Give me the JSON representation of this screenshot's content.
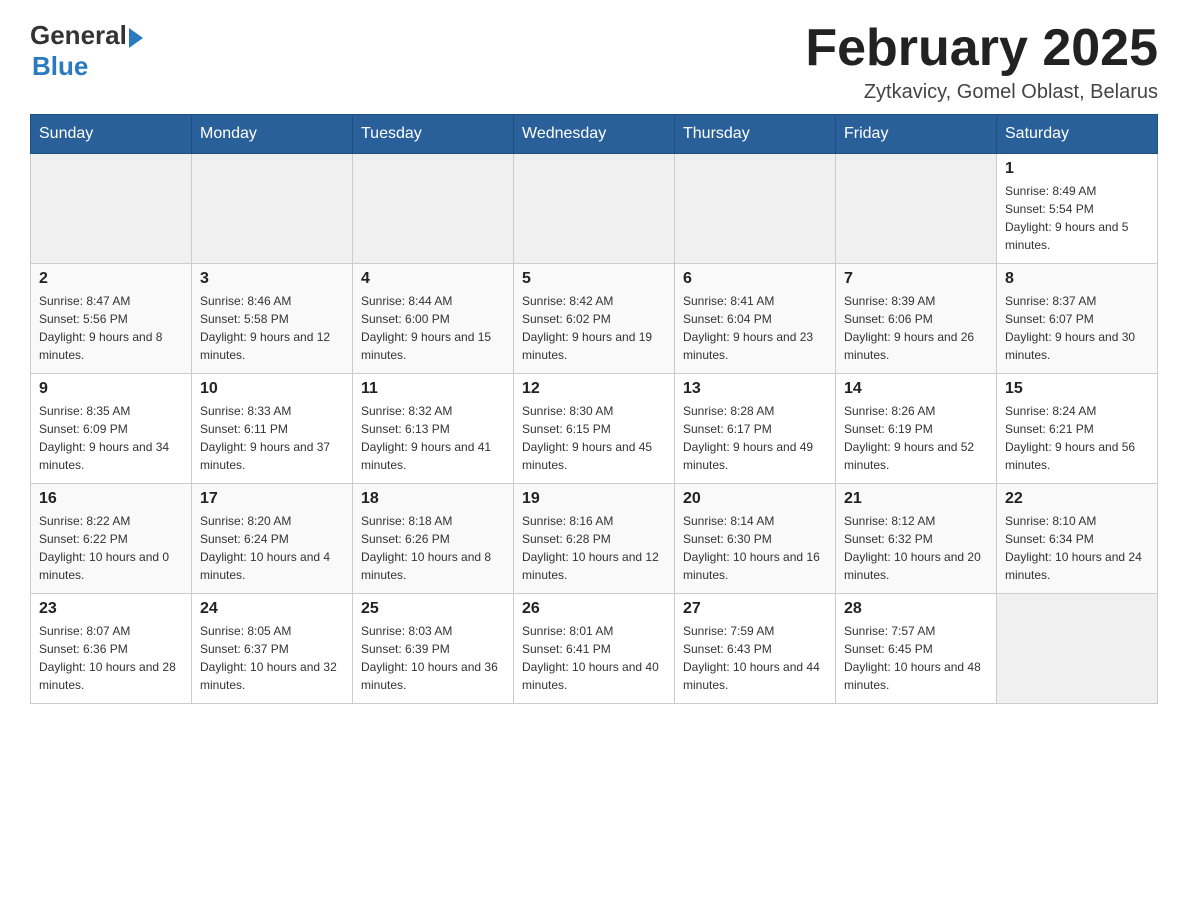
{
  "header": {
    "logo_general": "General",
    "logo_blue": "Blue",
    "month": "February 2025",
    "location": "Zytkavicy, Gomel Oblast, Belarus"
  },
  "days_of_week": [
    "Sunday",
    "Monday",
    "Tuesday",
    "Wednesday",
    "Thursday",
    "Friday",
    "Saturday"
  ],
  "weeks": [
    [
      {
        "day": "",
        "info": ""
      },
      {
        "day": "",
        "info": ""
      },
      {
        "day": "",
        "info": ""
      },
      {
        "day": "",
        "info": ""
      },
      {
        "day": "",
        "info": ""
      },
      {
        "day": "",
        "info": ""
      },
      {
        "day": "1",
        "info": "Sunrise: 8:49 AM\nSunset: 5:54 PM\nDaylight: 9 hours and 5 minutes."
      }
    ],
    [
      {
        "day": "2",
        "info": "Sunrise: 8:47 AM\nSunset: 5:56 PM\nDaylight: 9 hours and 8 minutes."
      },
      {
        "day": "3",
        "info": "Sunrise: 8:46 AM\nSunset: 5:58 PM\nDaylight: 9 hours and 12 minutes."
      },
      {
        "day": "4",
        "info": "Sunrise: 8:44 AM\nSunset: 6:00 PM\nDaylight: 9 hours and 15 minutes."
      },
      {
        "day": "5",
        "info": "Sunrise: 8:42 AM\nSunset: 6:02 PM\nDaylight: 9 hours and 19 minutes."
      },
      {
        "day": "6",
        "info": "Sunrise: 8:41 AM\nSunset: 6:04 PM\nDaylight: 9 hours and 23 minutes."
      },
      {
        "day": "7",
        "info": "Sunrise: 8:39 AM\nSunset: 6:06 PM\nDaylight: 9 hours and 26 minutes."
      },
      {
        "day": "8",
        "info": "Sunrise: 8:37 AM\nSunset: 6:07 PM\nDaylight: 9 hours and 30 minutes."
      }
    ],
    [
      {
        "day": "9",
        "info": "Sunrise: 8:35 AM\nSunset: 6:09 PM\nDaylight: 9 hours and 34 minutes."
      },
      {
        "day": "10",
        "info": "Sunrise: 8:33 AM\nSunset: 6:11 PM\nDaylight: 9 hours and 37 minutes."
      },
      {
        "day": "11",
        "info": "Sunrise: 8:32 AM\nSunset: 6:13 PM\nDaylight: 9 hours and 41 minutes."
      },
      {
        "day": "12",
        "info": "Sunrise: 8:30 AM\nSunset: 6:15 PM\nDaylight: 9 hours and 45 minutes."
      },
      {
        "day": "13",
        "info": "Sunrise: 8:28 AM\nSunset: 6:17 PM\nDaylight: 9 hours and 49 minutes."
      },
      {
        "day": "14",
        "info": "Sunrise: 8:26 AM\nSunset: 6:19 PM\nDaylight: 9 hours and 52 minutes."
      },
      {
        "day": "15",
        "info": "Sunrise: 8:24 AM\nSunset: 6:21 PM\nDaylight: 9 hours and 56 minutes."
      }
    ],
    [
      {
        "day": "16",
        "info": "Sunrise: 8:22 AM\nSunset: 6:22 PM\nDaylight: 10 hours and 0 minutes."
      },
      {
        "day": "17",
        "info": "Sunrise: 8:20 AM\nSunset: 6:24 PM\nDaylight: 10 hours and 4 minutes."
      },
      {
        "day": "18",
        "info": "Sunrise: 8:18 AM\nSunset: 6:26 PM\nDaylight: 10 hours and 8 minutes."
      },
      {
        "day": "19",
        "info": "Sunrise: 8:16 AM\nSunset: 6:28 PM\nDaylight: 10 hours and 12 minutes."
      },
      {
        "day": "20",
        "info": "Sunrise: 8:14 AM\nSunset: 6:30 PM\nDaylight: 10 hours and 16 minutes."
      },
      {
        "day": "21",
        "info": "Sunrise: 8:12 AM\nSunset: 6:32 PM\nDaylight: 10 hours and 20 minutes."
      },
      {
        "day": "22",
        "info": "Sunrise: 8:10 AM\nSunset: 6:34 PM\nDaylight: 10 hours and 24 minutes."
      }
    ],
    [
      {
        "day": "23",
        "info": "Sunrise: 8:07 AM\nSunset: 6:36 PM\nDaylight: 10 hours and 28 minutes."
      },
      {
        "day": "24",
        "info": "Sunrise: 8:05 AM\nSunset: 6:37 PM\nDaylight: 10 hours and 32 minutes."
      },
      {
        "day": "25",
        "info": "Sunrise: 8:03 AM\nSunset: 6:39 PM\nDaylight: 10 hours and 36 minutes."
      },
      {
        "day": "26",
        "info": "Sunrise: 8:01 AM\nSunset: 6:41 PM\nDaylight: 10 hours and 40 minutes."
      },
      {
        "day": "27",
        "info": "Sunrise: 7:59 AM\nSunset: 6:43 PM\nDaylight: 10 hours and 44 minutes."
      },
      {
        "day": "28",
        "info": "Sunrise: 7:57 AM\nSunset: 6:45 PM\nDaylight: 10 hours and 48 minutes."
      },
      {
        "day": "",
        "info": ""
      }
    ]
  ]
}
